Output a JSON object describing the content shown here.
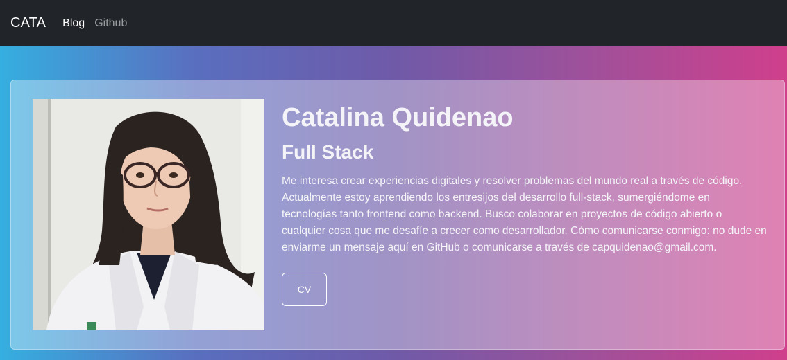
{
  "navbar": {
    "brand": "CATA",
    "links": [
      {
        "label": "Blog"
      },
      {
        "label": "Github"
      }
    ]
  },
  "profile": {
    "name": "Catalina Quidenao",
    "role": "Full Stack",
    "bio": "Me interesa crear experiencias digitales y resolver problemas del mundo real a través de código. Actualmente estoy aprendiendo los entresijos del desarrollo full-stack, sumergiéndome en tecnologías tanto frontend como backend. Busco colaborar en proyectos de código abierto o cualquier cosa que me desafíe a crecer como desarrollador. Cómo comunicarse conmigo: no dude en enviarme un mensaje aquí en GitHub o comunicarse a través de capquidenao@gmail.com.",
    "cv_button": "CV",
    "photo_alt": "profile-photo"
  },
  "colors": {
    "navbar_bg": "#212529",
    "gradient_start": "#35aee0",
    "gradient_end": "#cf3f8c"
  }
}
